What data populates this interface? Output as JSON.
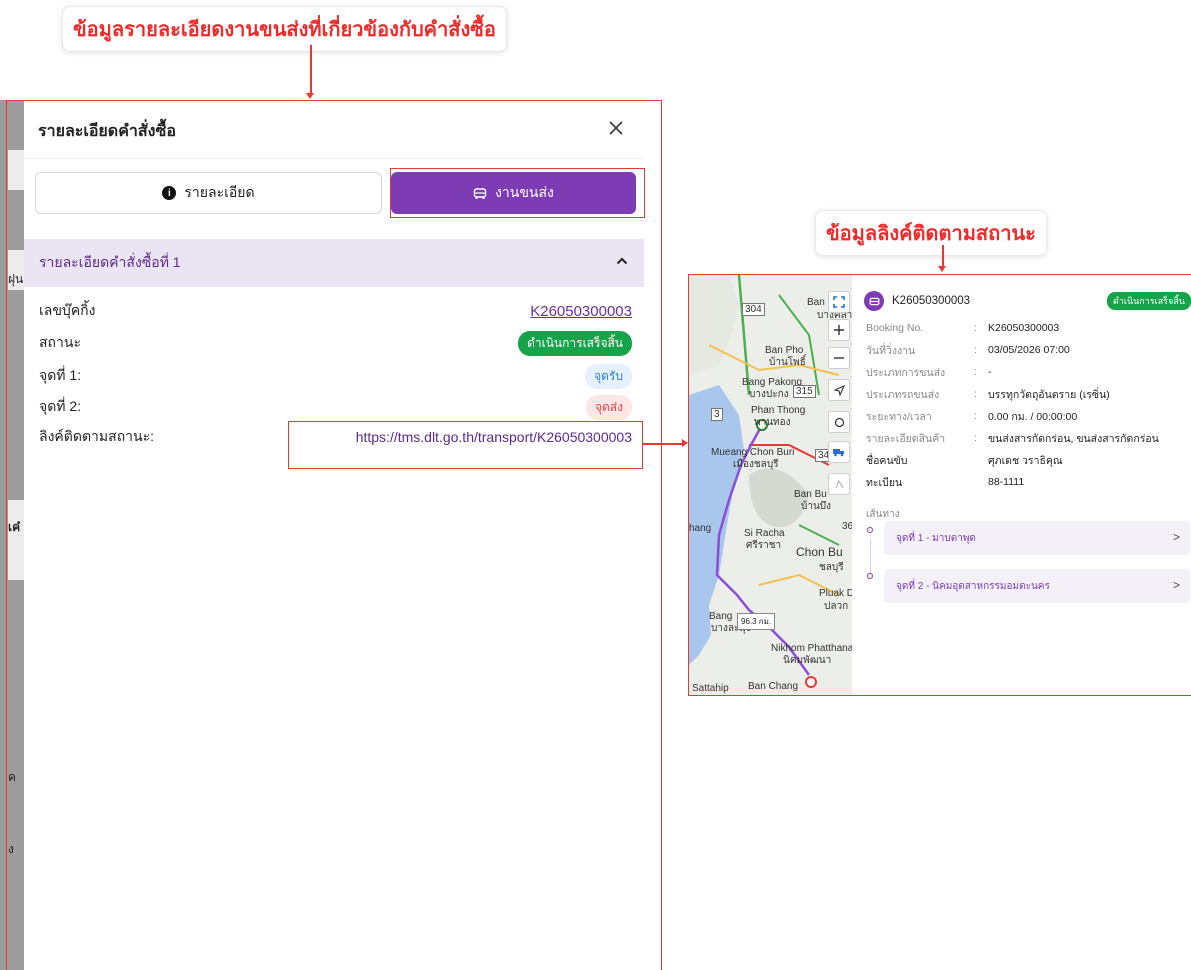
{
  "callouts": {
    "top": "ข้อมูลรายละเอียดงานขนส่งที่เกี่ยวข้องกับคำสั่งซื้อ",
    "right": "ข้อมูลลิงค์ติดตามสถานะ"
  },
  "background": {
    "fragment_1": "ฝุน",
    "fragment_2": "เค๋",
    "fragment_3": "ค",
    "fragment_4": "ง"
  },
  "modal": {
    "title": "รายละเอียดคำสั่งซื้อ",
    "tabs": {
      "details": "รายละเอียด",
      "transport": "งานขนส่ง",
      "active": "transport"
    },
    "section_title": "รายละเอียดคำสั่งซื้อที่ 1",
    "rows": {
      "booking_label": "เลขบุ๊คกิ้ง",
      "booking_value": "K26050300003",
      "status_label": "สถานะ",
      "status_value": "ดำเนินการเสร็จสิ้น",
      "point1_label": "จุดที่ 1:",
      "point1_value": "จุดรับ",
      "point2_label": "จุดที่ 2:",
      "point2_value": "จุดส่ง",
      "tracking_label": "ลิงค์ติดตามสถานะ:",
      "tracking_value": "https://tms.dlt.go.th/transport/K26050300003"
    }
  },
  "tracking_panel": {
    "booking_id": "K26050300003",
    "status": "ดำเนินการเสร็จสิ้น",
    "fields": {
      "booking_no_label": "Booking No.",
      "booking_no_value": "K26050300003",
      "work_date_label": "วันที่วิ่งงาน",
      "work_date_value": "03/05/2026 07:00",
      "transport_type_label": "ประเภทการขนส่ง",
      "transport_type_value": "-",
      "transporter_type_label": "ประเภทรถขนส่ง",
      "transporter_type_value": "บรรทุกวัตถุอันตราย (เรซิ่น)",
      "distance_label": "ระยะทาง/เวลา",
      "distance_value": "0.00 กม. / 00:00:00",
      "goods_label": "รายละเอียดสินค้า",
      "goods_value": "ขนส่งสารกัดกร่อน, ขนส่งสารกัดกร่อน",
      "driver_label": "ชื่อคนขับ",
      "driver_value": "ศุภเดช วราธิคุณ",
      "plate_label": "ทะเบียน",
      "plate_value": "88-1111"
    },
    "route_title": "เส้นทาง",
    "route_points": {
      "point1": "จุดที่ 1 - มาบตาพุด",
      "point2": "จุดที่ 2 - นิคมอุตสาหกรรมอมตะนคร"
    },
    "map": {
      "distance_tag": "96.3 กม.",
      "label_bang_pakong": "Bang Pakong",
      "label_bang_pakong_th": "บางปะกง",
      "label_ban_pho": "Ban Pho",
      "label_ban_pho_th": "บ้านโพธิ์",
      "label_phan_thong": "Phan Thong",
      "label_phan_thong_th": "พานทอง",
      "label_mueang": "Mueang Chon Buri",
      "label_mueang_th": "เมืองชลบุรี",
      "label_si_racha": "Si Racha",
      "label_si_racha_th": "ศรีราชา",
      "label_chon_buri": "Chon Bu",
      "label_chon_buri_th": "ชลบุรี",
      "label_pluak_daeng": "Pluak D",
      "label_pluak_daeng_th": "ปลวก",
      "label_nikhom": "Nikhom Phatthana",
      "label_nikhom_th": "นิคมพัฒนา",
      "label_sattahip": "Sattahip",
      "label_ban_chang": "Ban Chang",
      "label_ban_bueng": "Ban Bu",
      "label_ban_bueng_th": "บ้านบึง",
      "label_bang_lamung": "Bang",
      "label_bang_lamung_th": "บางละมุง",
      "label_ban_top": "Ban",
      "label_ban_top_th": "บางคล้า",
      "road_304": "304",
      "road_315": "315",
      "road_3": "3",
      "road_34": "34",
      "road_36": "36",
      "label_hang": "hang"
    }
  }
}
